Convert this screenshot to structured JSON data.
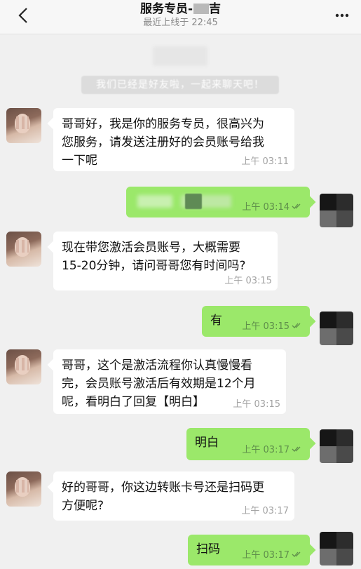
{
  "header": {
    "title_visible": "服务专员-",
    "title_tail": "吉",
    "status": "最近上线于 22:45"
  },
  "system_note": "我们已经是好友啦，一起来聊天吧！",
  "messages": [
    {
      "text": "哥哥好，我是你的服务专员，很高兴为您服务，请发送注册好的会员账号给我一下呢",
      "lines": [
        "哥哥好，我是你的服务专员，很高兴为",
        "您服务，请发送注册好的会员账号给我",
        "一下呢"
      ],
      "time": "上午 03:11"
    },
    {
      "text": "",
      "time": "上午 03:14"
    },
    {
      "lines": [
        "现在带您激活会员账号，大概需要",
        "15-20分钟，请问哥哥您有时间吗?"
      ],
      "time": "上午 03:15"
    },
    {
      "text": "有",
      "time": "上午 03:15"
    },
    {
      "lines": [
        "哥哥，这个是激活流程你认真慢慢看",
        "完，会员账号激活后有效期是12个月",
        "呢，看明白了回复【明白】"
      ],
      "time": "上午 03:15"
    },
    {
      "text": "明白",
      "time": "上午 03:17"
    },
    {
      "lines": [
        "好的哥哥，你这边转账卡号还是扫码更",
        "方便呢?"
      ],
      "time": "上午 03:17"
    },
    {
      "text": "扫码",
      "time": "上午 03:17"
    }
  ],
  "colors": {
    "outgoing_bubble": "#9be86a",
    "incoming_bubble": "#ffffff",
    "background": "#f0f0f0"
  },
  "icons": [
    "back-icon",
    "more-icon",
    "read-ticks-icon"
  ]
}
